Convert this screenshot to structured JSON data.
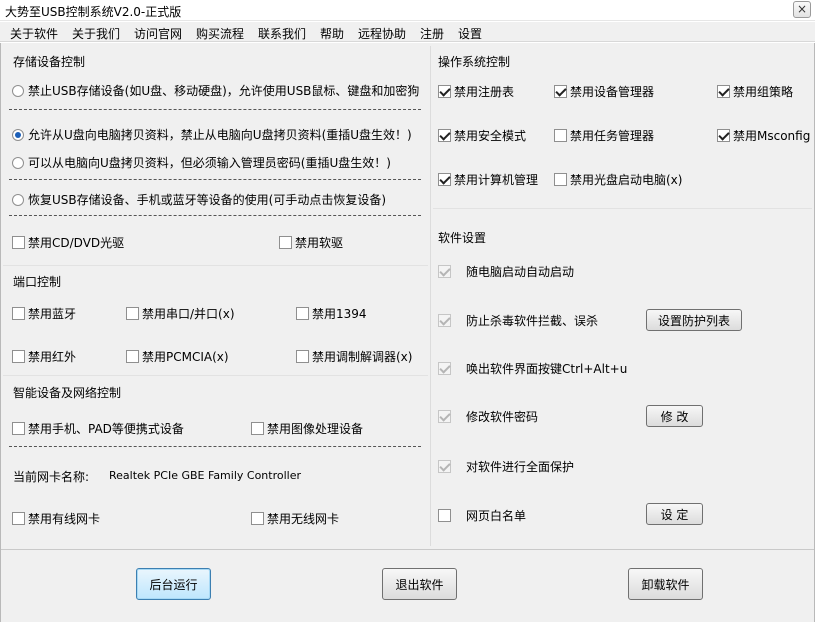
{
  "window": {
    "title": "大势至USB控制系统V2.0-正式版",
    "close_symbol": "×"
  },
  "menu": [
    "关于软件",
    "关于我们",
    "访问官网",
    "购买流程",
    "联系我们",
    "帮助",
    "远程协助",
    "注册",
    "设置"
  ],
  "storage": {
    "title": "存储设备控制",
    "radios": [
      {
        "label": "禁止USB存储设备(如U盘、移动硬盘)，允许使用USB鼠标、键盘和加密狗",
        "selected": false
      },
      {
        "label": "允许从U盘向电脑拷贝资料，禁止从电脑向U盘拷贝资料(重插U盘生效！)",
        "selected": true
      },
      {
        "label": "可以从电脑向U盘拷贝资料，但必须输入管理员密码(重插U盘生效！)",
        "selected": false
      },
      {
        "label": "恢复USB存储设备、手机或蓝牙等设备的使用(可手动点击恢复设备)",
        "selected": false
      }
    ],
    "disable_cd": "禁用CD/DVD光驱",
    "disable_floppy": "禁用软驱"
  },
  "port": {
    "title": "端口控制",
    "items": [
      "禁用蓝牙",
      "禁用串口/并口(x)",
      "禁用1394",
      "禁用红外",
      "禁用PCMCIA(x)",
      "禁用调制解调器(x)"
    ]
  },
  "smart": {
    "title": "智能设备及网络控制",
    "disable_phone": "禁用手机、PAD等便携式设备",
    "disable_imaging": "禁用图像处理设备",
    "nic_label": "当前网卡名称:",
    "nic_value": "Realtek PCIe GBE Family Controller",
    "disable_wired": "禁用有线网卡",
    "disable_wireless": "禁用无线网卡"
  },
  "os": {
    "title": "操作系统控制",
    "items": [
      {
        "label": "禁用注册表",
        "checked": true
      },
      {
        "label": "禁用设备管理器",
        "checked": true
      },
      {
        "label": "禁用组策略",
        "checked": true
      },
      {
        "label": "禁用安全模式",
        "checked": true
      },
      {
        "label": "禁用任务管理器",
        "checked": false
      },
      {
        "label": "禁用Msconfig",
        "checked": true
      },
      {
        "label": "禁用计算机管理",
        "checked": true
      },
      {
        "label": "禁用光盘启动电脑(x)",
        "checked": false
      }
    ]
  },
  "software": {
    "title": "软件设置",
    "items": [
      {
        "label": "随电脑启动自动启动",
        "checked": true,
        "disabled": true
      },
      {
        "label": "防止杀毒软件拦截、误杀",
        "checked": true,
        "disabled": true
      },
      {
        "label": "唤出软件界面按键Ctrl+Alt+u",
        "checked": true,
        "disabled": true
      },
      {
        "label": "修改软件密码",
        "checked": true,
        "disabled": true
      },
      {
        "label": "对软件进行全面保护",
        "checked": true,
        "disabled": true
      },
      {
        "label": "网页白名单",
        "checked": false,
        "disabled": false
      }
    ],
    "protect_list_button": "设置防护列表",
    "modify_button": "修 改",
    "set_button": "设 定"
  },
  "bottom": {
    "background_run": "后台运行",
    "exit": "退出软件",
    "uninstall": "卸载软件"
  }
}
